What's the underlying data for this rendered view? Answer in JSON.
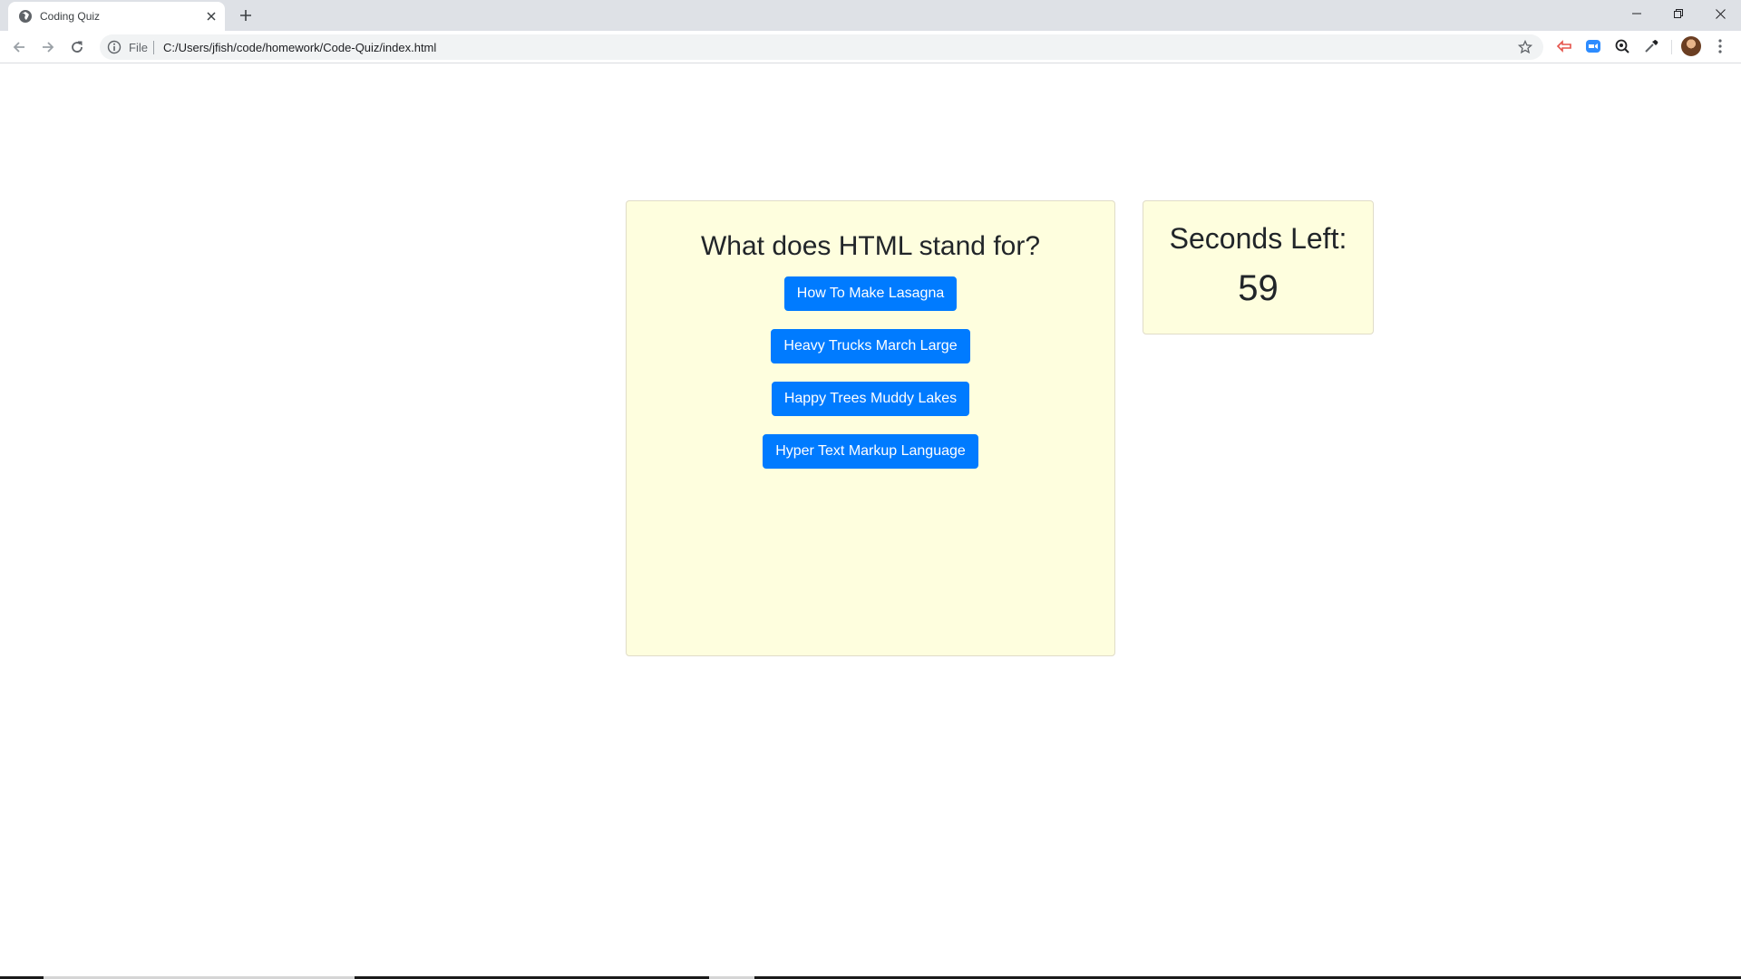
{
  "browser": {
    "tab_title": "Coding Quiz",
    "new_tab_symbol": "+",
    "scheme_label": "File",
    "url": "C:/Users/jfish/code/homework/Code-Quiz/index.html"
  },
  "quiz": {
    "question": "What does HTML stand for?",
    "answers": [
      "How To Make Lasagna",
      "Heavy Trucks March Large",
      "Happy Trees Muddy Lakes",
      "Hyper Text Markup Language"
    ]
  },
  "timer": {
    "label": "Seconds Left:",
    "value": "59"
  },
  "colors": {
    "button": "#007bff",
    "card_background": "#fefede"
  },
  "icons": [
    "globe-icon",
    "close-icon",
    "plus-icon",
    "back-icon",
    "forward-icon",
    "reload-icon",
    "info-icon",
    "star-icon",
    "extension-icon",
    "zoom-icon",
    "search-icon",
    "eyedropper-icon",
    "menu-icon"
  ]
}
